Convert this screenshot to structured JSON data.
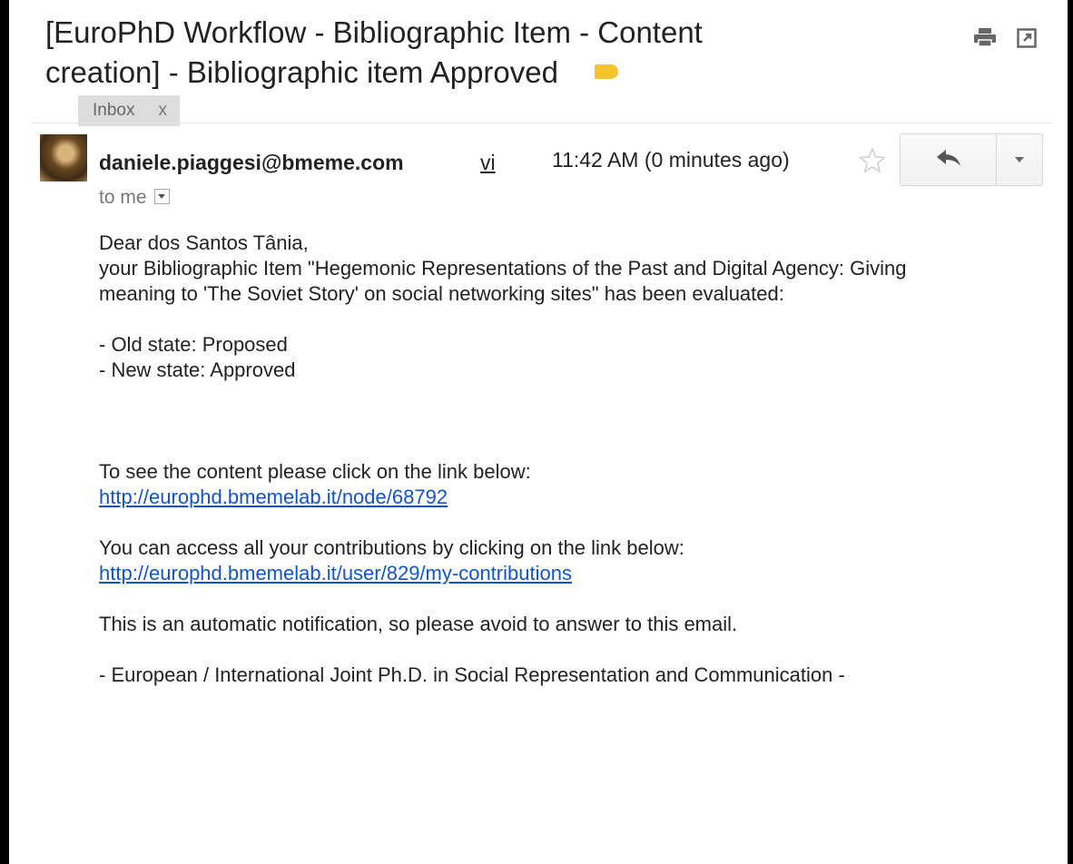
{
  "subject": "[EuroPhD Workflow - Bibliographic Item - Content creation] - Bibliographic item Approved",
  "label_chip": {
    "label": "Inbox",
    "close": "x"
  },
  "icons": {
    "print": "print-icon",
    "new_window": "new-window-icon",
    "tag": "importance-tag-icon",
    "star": "star-icon",
    "reply": "reply-icon",
    "more": "chevron-down-icon"
  },
  "colors": {
    "tag": "#f4c430",
    "link": "#1155cc"
  },
  "message": {
    "sender": "daniele.piaggesi@bmeme.com",
    "via": "vi",
    "time": "11:42 AM (0 minutes ago)",
    "to": "to me"
  },
  "body": {
    "greeting": "Dear dos Santos Tânia,",
    "intro": "your Bibliographic Item \"Hegemonic Representations of the Past and Digital Agency: Giving meaning to 'The Soviet Story' on social networking sites\" has been evaluated:",
    "old_state": "- Old state: Proposed",
    "new_state": "- New state: Approved",
    "see_content": "To see the content please click on the link below:",
    "content_link": "http://europhd.bmemelab.it/node/68792",
    "access_contrib": "You can access all your contributions by clicking on the link below:",
    "contrib_link": "http://europhd.bmemelab.it/user/829/my-contributions",
    "auto_notice": "This is an automatic notification, so please avoid to answer to this email.",
    "signature": "- European / International Joint Ph.D. in Social Representation and Communication -"
  }
}
